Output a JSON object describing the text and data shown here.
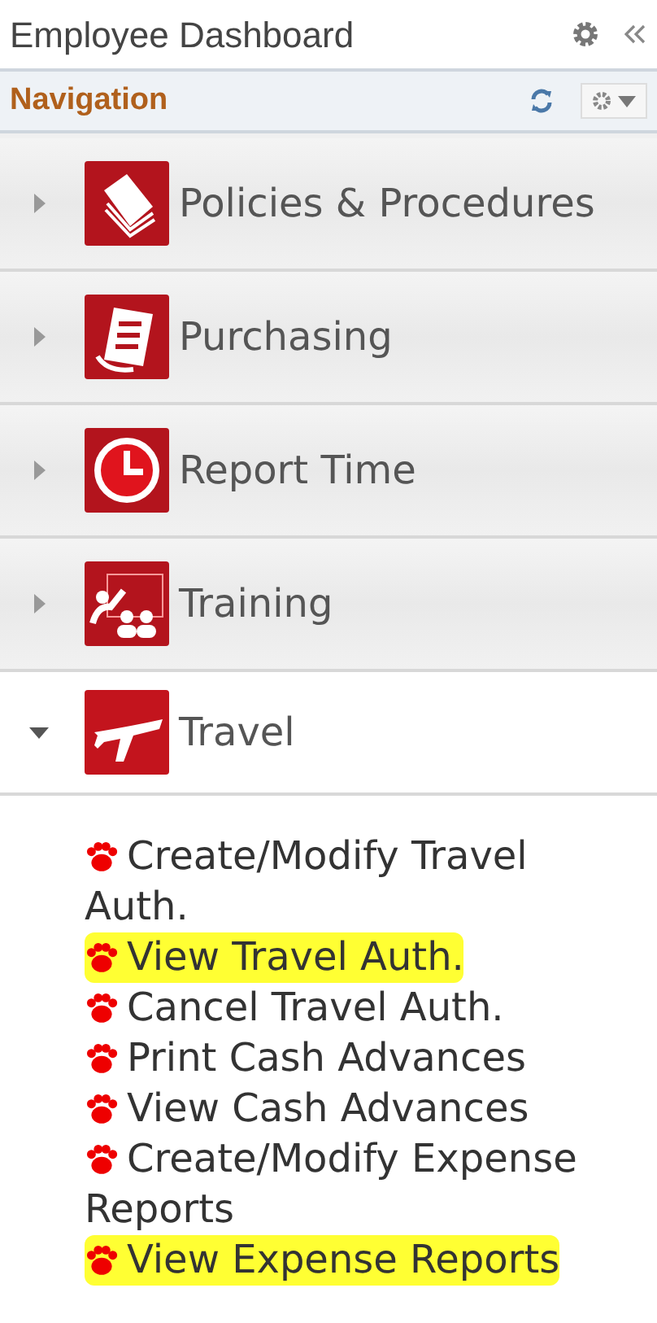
{
  "panel": {
    "title": "Employee Dashboard"
  },
  "navigation": {
    "title": "Navigation"
  },
  "categories": [
    {
      "label": "Policies & Procedures",
      "expanded": false
    },
    {
      "label": "Purchasing",
      "expanded": false
    },
    {
      "label": "Report Time",
      "expanded": false
    },
    {
      "label": "Training",
      "expanded": false
    },
    {
      "label": "Travel",
      "expanded": true,
      "children": [
        {
          "label": "Create/Modify Travel Auth.",
          "highlighted": false
        },
        {
          "label": "View Travel Auth.",
          "highlighted": true
        },
        {
          "label": "Cancel Travel Auth.",
          "highlighted": false
        },
        {
          "label": "Print Cash Advances",
          "highlighted": false
        },
        {
          "label": "View Cash Advances",
          "highlighted": false
        },
        {
          "label": "Create/Modify Expense Reports",
          "highlighted": false
        },
        {
          "label": "View Expense Reports",
          "highlighted": true
        }
      ]
    }
  ]
}
